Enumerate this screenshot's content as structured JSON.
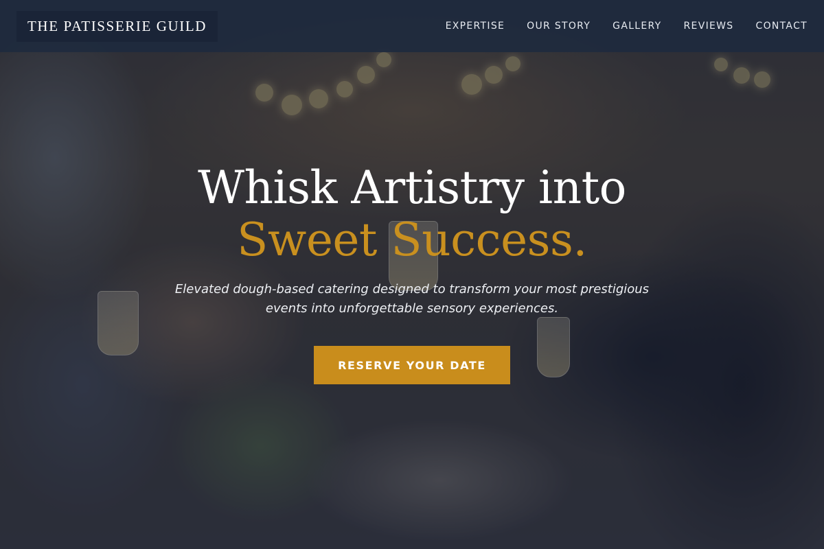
{
  "navbar": {
    "brand": "THE PATISSERIE GUILD",
    "links": [
      {
        "label": "EXPERTISE"
      },
      {
        "label": "OUR STORY"
      },
      {
        "label": "GALLERY"
      },
      {
        "label": "REVIEWS"
      },
      {
        "label": "CONTACT"
      }
    ]
  },
  "hero": {
    "headline_line1": "Whisk Artistry into",
    "headline_line2": "Sweet Success.",
    "tagline": "Elevated dough-based catering designed to transform your most prestigious events into unforgettable sensory experiences.",
    "cta_label": "RESERVE YOUR DATE"
  },
  "colors": {
    "navbar_bg": "#1e2a3e",
    "accent_gold": "#c98d1c",
    "headline_white": "#ffffff"
  }
}
